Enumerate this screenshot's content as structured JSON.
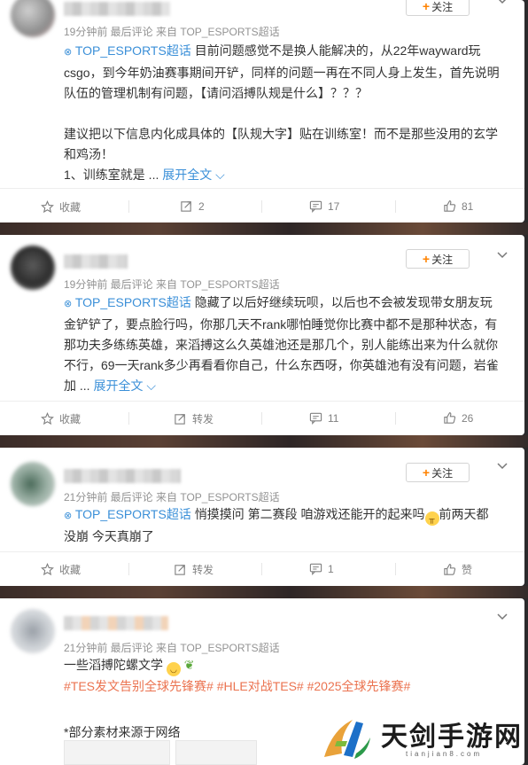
{
  "posts": [
    {
      "meta": "19分钟前  最后评论  来自 TOP_ESPORTS超话",
      "follow_label": "关注",
      "topic": "TOP_ESPORTS超话",
      "text_lines": [
        "目前问题感觉不是换人能解决的，从22年wayward玩",
        "csgo，到今年奶油赛事期间开铲，同样的问题一再在不同人身上发生，首先说明",
        "队伍的管理机制有问题，【请问滔搏队规是什么】？？？",
        "",
        "建议把以下信息内化成具体的【队规大字】贴在训练室！而不是那些没用的玄学",
        "和鸡汤！",
        "1、训练室就是 ..."
      ],
      "expand_label": "展开全文",
      "actions": {
        "favorite": "收藏",
        "repost": "2",
        "comment": "17",
        "like": "81"
      }
    },
    {
      "meta": "19分钟前  最后评论  来自 TOP_ESPORTS超话",
      "follow_label": "关注",
      "topic": "TOP_ESPORTS超话",
      "text_lines": [
        "隐藏了以后好继续玩呗，以后也不会被发现带女朋友玩",
        "金铲铲了，要点脸行吗，你那几天不rank哪怕睡觉你比赛中都不是那种状态，有",
        "那功夫多练练英雄，来滔搏这么久英雄池还是那几个，别人能练出来为什么就你",
        "不行，69一天rank多少再看看你自己，什么东西呀，你英雄池有没有问题，岩雀",
        "加 ..."
      ],
      "expand_label": "展开全文",
      "actions": {
        "favorite": "收藏",
        "repost": "转发",
        "comment": "11",
        "like": "26"
      }
    },
    {
      "meta": "21分钟前  最后评论  来自 TOP_ESPORTS超话",
      "follow_label": "关注",
      "topic": "TOP_ESPORTS超话",
      "text_lines": [
        "悄摸摸问 第二赛段 咱游戏还能开的起来吗",
        "前两天都",
        "没崩 今天真崩了"
      ],
      "actions": {
        "favorite": "收藏",
        "repost": "转发",
        "comment": "1",
        "like": "赞"
      }
    },
    {
      "meta": "21分钟前  最后评论  来自 TOP_ESPORTS超话",
      "text_line": "一些滔搏陀螺文学",
      "hashtags": "#TES发文告别全球先锋赛# #HLE对战TES# #2025全球先锋赛#",
      "note": "*部分素材来源于网络"
    }
  ],
  "watermark": {
    "title": "天剑手游网",
    "subtitle": "tianjian8.com"
  },
  "colors": {
    "accent_orange": "#ff8200",
    "link_blue": "#3a8fd8",
    "hashtag": "#eb7350"
  }
}
